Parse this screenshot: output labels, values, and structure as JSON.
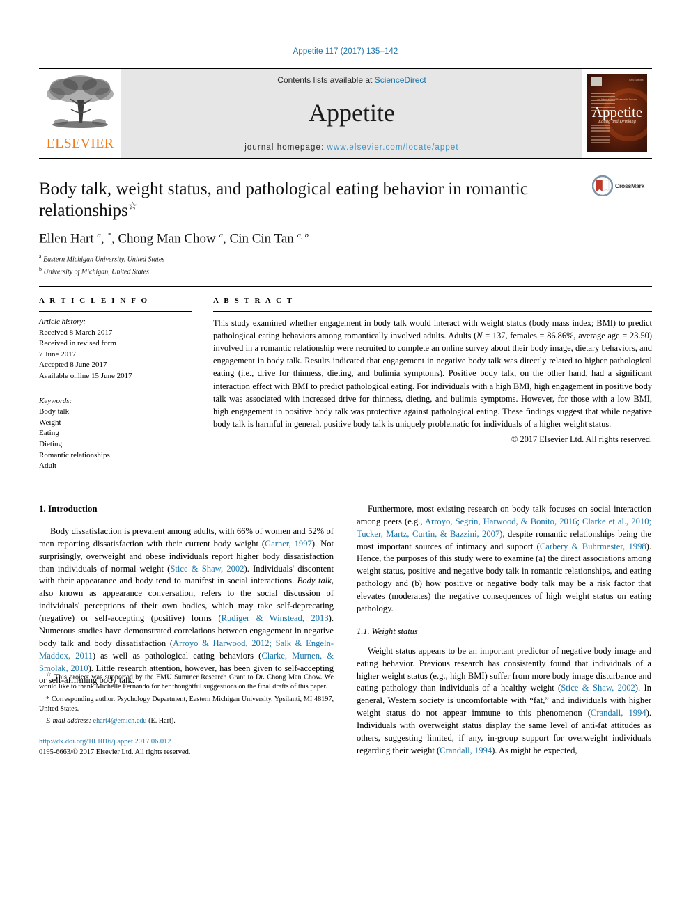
{
  "running_head": "Appetite 117 (2017) 135–142",
  "masthead": {
    "publisher": "ELSEVIER",
    "contents_prefix": "Contents lists available at ",
    "contents_link": "ScienceDirect",
    "journal_name": "Appetite",
    "homepage_label": "journal homepage: ",
    "homepage_url": "www.elsevier.com/locate/appet",
    "cover": {
      "title": "Appetite",
      "subtitle": "Eating and Drinking",
      "kicker": "An International Research Journal"
    }
  },
  "article": {
    "title": "Body talk, weight status, and pathological eating behavior in romantic relationships",
    "title_marker": "☆",
    "authors_html": "Ellen Hart <sup>a</sup>, <sup>*</sup>, Chong Man Chow <sup>a</sup>, Cin Cin Tan <sup>a, b</sup>",
    "affiliations": [
      {
        "marker": "a",
        "text": "Eastern Michigan University, United States"
      },
      {
        "marker": "b",
        "text": "University of Michigan, United States"
      }
    ],
    "crossmark_label": "CrossMark"
  },
  "article_info": {
    "heading": "A R T I C L E   I N F O",
    "history_label": "Article history:",
    "history": [
      "Received 8 March 2017",
      "Received in revised form",
      "7 June 2017",
      "Accepted 8 June 2017",
      "Available online 15 June 2017"
    ],
    "keywords_label": "Keywords:",
    "keywords": [
      "Body talk",
      "Weight",
      "Eating",
      "Dieting",
      "Romantic relationships",
      "Adult"
    ]
  },
  "abstract": {
    "heading": "A B S T R A C T",
    "text_html": "This study examined whether engagement in body talk would interact with weight status (body mass index; BMI) to predict pathological eating behaviors among romantically involved adults. Adults (<span class=\"it\">N</span> = 137, females = 86.86%, average age = 23.50) involved in a romantic relationship were recruited to complete an online survey about their body image, dietary behaviors, and engagement in body talk. Results indicated that engagement in negative body talk was directly related to higher pathological eating (i.e., drive for thinness, dieting, and bulimia symptoms). Positive body talk, on the other hand, had a significant interaction effect with BMI to predict pathological eating. For individuals with a high BMI, high engagement in positive body talk was associated with increased drive for thinness, dieting, and bulimia symptoms. However, for those with a low BMI, high engagement in positive body talk was protective against pathological eating. These findings suggest that while negative body talk is harmful in general, positive body talk is uniquely problematic for individuals of a higher weight status.",
    "copyright": "© 2017 Elsevier Ltd. All rights reserved."
  },
  "body": {
    "left": {
      "section_heading": "1. Introduction",
      "paragraph_html": "Body dissatisfaction is prevalent among adults, with 66% of women and 52% of men reporting dissatisfaction with their current body weight (<span class=\"cite\">Garner, 1997</span>). Not surprisingly, overweight and obese individuals report higher body dissatisfaction than individuals of normal weight (<span class=\"cite\">Stice &amp; Shaw, 2002</span>). Individuals' discontent with their appearance and body tend to manifest in social interactions. <span class=\"it\">Body talk</span>, also known as appearance conversation, refers to the social discussion of individuals' perceptions of their own bodies, which may take self-deprecating (negative) or self-accepting (positive) forms (<span class=\"cite\">Rudiger &amp; Winstead, 2013</span>). Numerous studies have demonstrated correlations between engagement in negative body talk and body dissatisfaction (<span class=\"cite\">Arroyo &amp; Harwood, 2012; Salk &amp; Engeln-Maddox, 2011</span>) as well as pathological eating behaviors (<span class=\"cite\">Clarke, Murnen, &amp; Smolak, 2010</span>). Little research attention, however, has been given to self-accepting or self-affirming body talk."
    },
    "right": {
      "paragraph_html": "Furthermore, most existing research on body talk focuses on social interaction among peers (e.g., <span class=\"cite\">Arroyo, Segrin, Harwood, &amp; Bonito, 2016</span>; <span class=\"cite\">Clarke et al., 2010; Tucker, Martz, Curtin, &amp; Bazzini, 2007</span>), despite romantic relationships being the most important sources of intimacy and support (<span class=\"cite\">Carbery &amp; Buhrmester, 1998</span>). Hence, the purposes of this study were to examine (a) the direct associations among weight status, positive and negative body talk in romantic relationships, and eating pathology and (b) how positive or negative body talk may be a risk factor that elevates (moderates) the negative consequences of high weight status on eating pathology.",
      "subsection_heading": "1.1. Weight status",
      "subsection_paragraph_html": "Weight status appears to be an important predictor of negative body image and eating behavior. Previous research has consistently found that individuals of a higher weight status (e.g., high BMI) suffer from more body image disturbance and eating pathology than individuals of a healthy weight (<span class=\"cite\">Stice &amp; Shaw, 2002</span>). In general, Western society is uncomfortable with “fat,” and individuals with higher weight status do not appear immune to this phenomenon (<span class=\"cite\">Crandall, 1994</span>). Individuals with overweight status display the same level of anti-fat attitudes as others, suggesting limited, if any, in-group support for overweight individuals regarding their weight (<span class=\"cite\">Crandall, 1994</span>). As might be expected,"
    }
  },
  "footnotes": {
    "funding_html": "<sup>☆</sup> This project was supported by the EMU Summer Research Grant to Dr. Chong Man Chow. We would like to thank Michelle Fernando for her thoughtful suggestions on the final drafts of this paper.",
    "corresponding_html": "* Corresponding author. Psychology Department, Eastern Michigan University, Ypsilanti, MI 48197, United States.",
    "email_label": "E-mail address:",
    "email": "ehart4@emich.edu",
    "email_owner": "(E. Hart).",
    "doi": "http://dx.doi.org/10.1016/j.appet.2017.06.012",
    "issn_line": "0195-6663/© 2017 Elsevier Ltd. All rights reserved."
  },
  "colors": {
    "link": "#1a74a8",
    "elsevier_orange": "#f07c1b",
    "masthead_bg": "#e6e6e6"
  }
}
